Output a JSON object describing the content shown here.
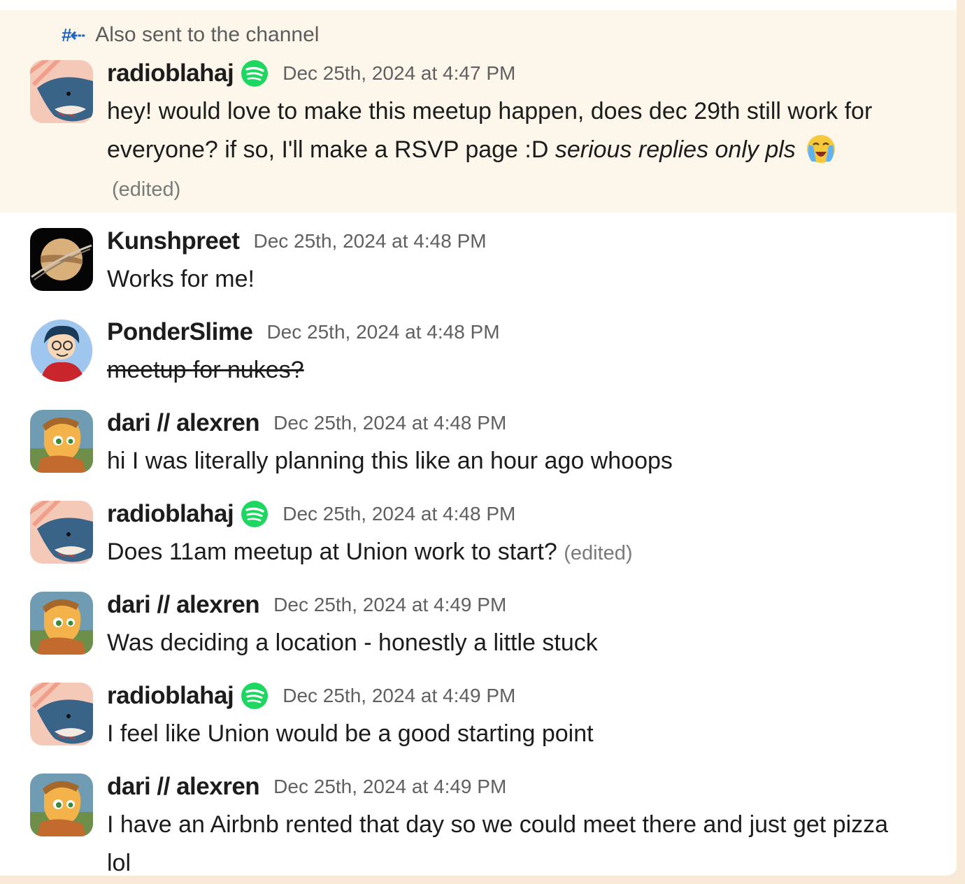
{
  "notice": {
    "icon": "hash-reply-icon",
    "text": "Also sent to the channel"
  },
  "badge_icon": "spotify-icon",
  "messages": [
    {
      "user": "radioblahaj",
      "time": "Dec 25th, 2024 at 4:47 PM",
      "text": "hey! would love to make this meetup happen, does dec 29th still work for everyone? if so, I'll make a RSVP page :D ",
      "italic": "serious replies only pls",
      "emoji": "crying-face-emoji",
      "edited": "(edited)"
    },
    {
      "user": "Kunshpreet",
      "time": "Dec 25th, 2024 at 4:48 PM",
      "text": "Works for me!"
    },
    {
      "user": "PonderSlime",
      "time": "Dec 25th, 2024 at 4:48 PM",
      "text": "meetup for nukes?",
      "strikethrough": true
    },
    {
      "user": "dari // alexren",
      "time": "Dec 25th, 2024 at 4:48 PM",
      "text": "hi I was literally planning this like an hour ago whoops"
    },
    {
      "user": "radioblahaj",
      "time": "Dec 25th, 2024 at 4:48 PM",
      "text": "Does 11am meetup at Union work to start?",
      "edited": "(edited)"
    },
    {
      "user": "dari // alexren",
      "time": "Dec 25th, 2024 at 4:49 PM",
      "text": "Was deciding a location - honestly a little stuck"
    },
    {
      "user": "radioblahaj",
      "time": "Dec 25th, 2024 at 4:49 PM",
      "text": "I feel like Union would be a good starting point"
    },
    {
      "user": "dari // alexren",
      "time": "Dec 25th, 2024 at 4:49 PM",
      "text": "I have an Airbnb rented that day so we could meet there and just get pizza lol"
    }
  ],
  "colors": {
    "highlight": "#fcf7ea",
    "outer": "#f8ead6",
    "spotify": "#1ed760",
    "link": "#1d64c8"
  }
}
